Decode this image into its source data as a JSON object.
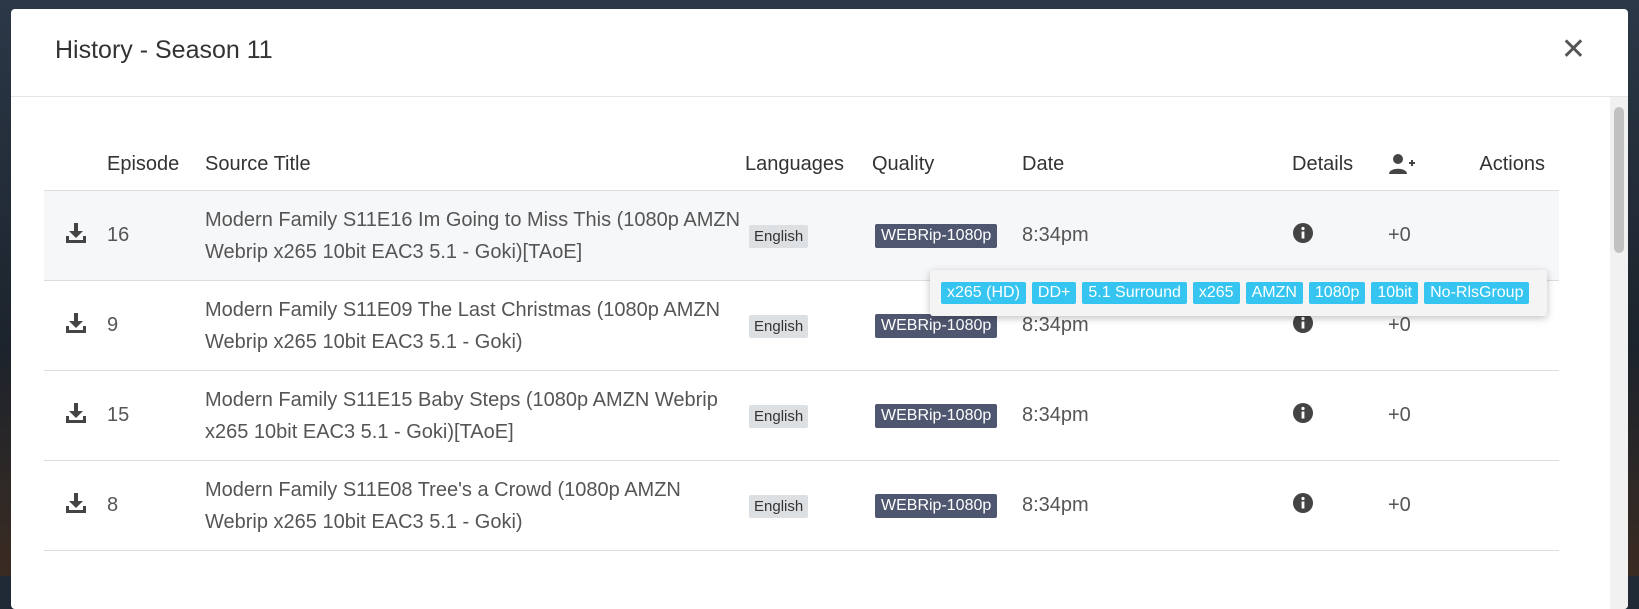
{
  "modal": {
    "title": "History - Season 11",
    "close_glyph": "✕"
  },
  "table": {
    "headers": {
      "episode": "Episode",
      "source_title": "Source Title",
      "languages": "Languages",
      "quality": "Quality",
      "date": "Date",
      "details": "Details",
      "actions": "Actions"
    },
    "rows": [
      {
        "episode": "16",
        "source_title": "Modern Family S11E16 Im Going to Miss This (1080p AMZN Webrip x265 10bit EAC3 5.1 - Goki)[TAoE]",
        "language": "English",
        "quality": "WEBRip-1080p",
        "date": "8:34pm",
        "custom_score": "+0"
      },
      {
        "episode": "9",
        "source_title": "Modern Family S11E09 The Last Christmas (1080p AMZN Webrip x265 10bit EAC3 5.1 - Goki)",
        "language": "English",
        "quality": "WEBRip-1080p",
        "date": "8:34pm",
        "custom_score": "+0"
      },
      {
        "episode": "15",
        "source_title": "Modern Family S11E15 Baby Steps (1080p AMZN Webrip x265 10bit EAC3 5.1 - Goki)[TAoE]",
        "language": "English",
        "quality": "WEBRip-1080p",
        "date": "8:34pm",
        "custom_score": "+0"
      },
      {
        "episode": "8",
        "source_title": "Modern Family S11E08 Tree's a Crowd (1080p AMZN Webrip x265 10bit EAC3 5.1 - Goki)",
        "language": "English",
        "quality": "WEBRip-1080p",
        "date": "8:34pm",
        "custom_score": "+0"
      }
    ]
  },
  "popover": {
    "tags": [
      "x265 (HD)",
      "DD+",
      "5.1 Surround",
      "x265",
      "AMZN",
      "1080p",
      "10bit",
      "No-RlsGroup"
    ]
  },
  "colors": {
    "tag_bg": "#35c5f0",
    "quality_bg": "#4f566f",
    "language_bg": "#dde0e3"
  },
  "icons": {
    "download": "download-icon",
    "details": "info-circle-icon",
    "custom_format": "user-plus-icon",
    "close": "close-icon"
  }
}
